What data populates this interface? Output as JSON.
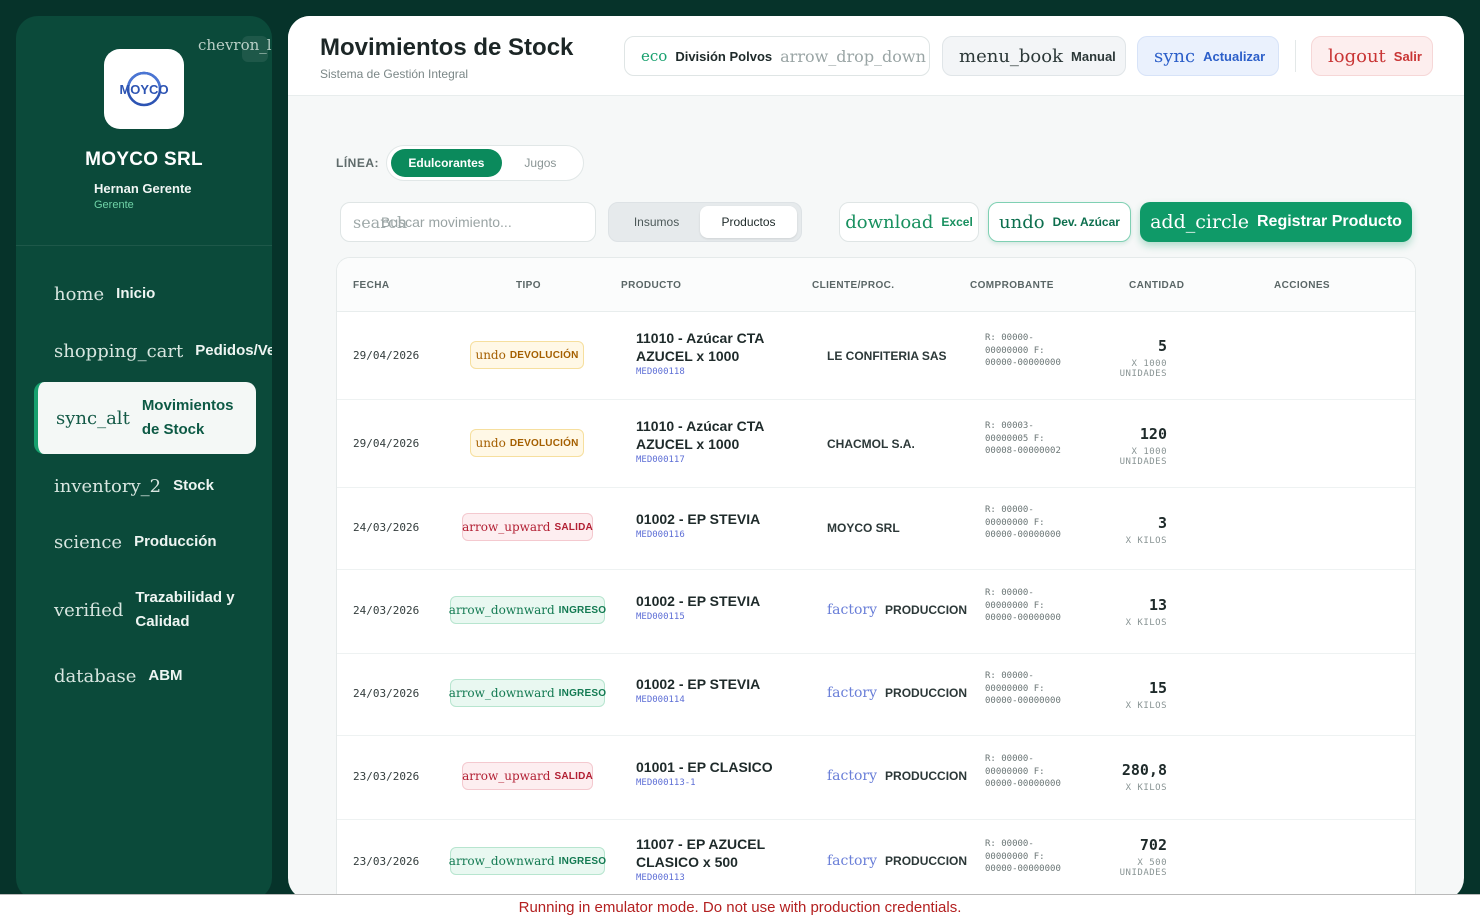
{
  "sidebar": {
    "collapse_icon": "chevron_left",
    "logo_text": "MOYCO",
    "company": "MOYCO SRL",
    "user_name": "Hernan Gerente",
    "user_role": "Gerente",
    "items": [
      {
        "icon": "home",
        "label": "Inicio"
      },
      {
        "icon": "shopping_cart",
        "label": "Pedidos/Ventas"
      },
      {
        "icon": "sync_alt",
        "label": "Movimientos de Stock",
        "active": true
      },
      {
        "icon": "inventory_2",
        "label": "Stock"
      },
      {
        "icon": "science",
        "label": "Producción"
      },
      {
        "icon": "verified",
        "label": "Trazabilidad y Calidad"
      },
      {
        "icon": "database",
        "label": "ABM"
      }
    ]
  },
  "header": {
    "title": "Movimientos de Stock",
    "subtitle": "Sistema de Gestión Integral",
    "division": {
      "icon": "eco",
      "label": "División Polvos",
      "arrow": "arrow_drop_down"
    },
    "manual": {
      "icon": "menu_book",
      "label": "Manual"
    },
    "sync": {
      "icon": "sync",
      "label": "Actualizar"
    },
    "logout": {
      "icon": "logout",
      "label": "Salir"
    }
  },
  "filters": {
    "linea_label": "LÍNEA:",
    "linea_options": [
      "Edulcorantes",
      "Jugos"
    ],
    "linea_selected": "Edulcorantes",
    "search_icon": "search",
    "search_placeholder": "Buscar movimiento...",
    "tipo_options": [
      "Insumos",
      "Productos"
    ],
    "tipo_selected": "Productos"
  },
  "actions": {
    "excel": {
      "icon": "download",
      "label": "Excel"
    },
    "dev": {
      "icon": "undo",
      "label": "Dev. Azúcar"
    },
    "register": {
      "icon": "add_circle",
      "label": "Registrar Producto"
    }
  },
  "table": {
    "columns": [
      "FECHA",
      "TIPO",
      "PRODUCTO",
      "CLIENTE/PROC.",
      "COMPROBANTE",
      "CANTIDAD",
      "ACCIONES"
    ],
    "rows": [
      {
        "fecha": "29/04/2026",
        "tipo_icon": "undo",
        "tipo": "DEVOLUCIÓN",
        "kind": "dev",
        "producto": "11010 - Azúcar CTA AZUCEL x 1000",
        "codigo": "MED000118",
        "cliente_icon": "",
        "cliente": "LE CONFITERIA SAS",
        "comprobante": "R: 00000-00000000 F: 00000-00000000",
        "cantidad": "5",
        "unidad": "X 1000 UNIDADES"
      },
      {
        "fecha": "29/04/2026",
        "tipo_icon": "undo",
        "tipo": "DEVOLUCIÓN",
        "kind": "dev",
        "producto": "11010 - Azúcar CTA AZUCEL x 1000",
        "codigo": "MED000117",
        "cliente_icon": "",
        "cliente": "CHACMOL S.A.",
        "comprobante": "R: 00003-00000005 F: 00008-00000002",
        "cantidad": "120",
        "unidad": "X 1000 UNIDADES"
      },
      {
        "fecha": "24/03/2026",
        "tipo_icon": "arrow_upward",
        "tipo": "SALIDA",
        "kind": "sal",
        "producto": "01002 - EP STEVIA",
        "codigo": "MED000116",
        "cliente_icon": "",
        "cliente": "MOYCO SRL",
        "comprobante": "R: 00000-00000000 F: 00000-00000000",
        "cantidad": "3",
        "unidad": "X KILOS"
      },
      {
        "fecha": "24/03/2026",
        "tipo_icon": "arrow_downward",
        "tipo": "INGRESO",
        "kind": "ing",
        "producto": "01002 - EP STEVIA",
        "codigo": "MED000115",
        "cliente_icon": "factory",
        "cliente": "PRODUCCION",
        "comprobante": "R: 00000-00000000 F: 00000-00000000",
        "cantidad": "13",
        "unidad": "X KILOS"
      },
      {
        "fecha": "24/03/2026",
        "tipo_icon": "arrow_downward",
        "tipo": "INGRESO",
        "kind": "ing",
        "producto": "01002 - EP STEVIA",
        "codigo": "MED000114",
        "cliente_icon": "factory",
        "cliente": "PRODUCCION",
        "comprobante": "R: 00000-00000000 F: 00000-00000000",
        "cantidad": "15",
        "unidad": "X KILOS"
      },
      {
        "fecha": "23/03/2026",
        "tipo_icon": "arrow_upward",
        "tipo": "SALIDA",
        "kind": "sal",
        "producto": "01001 - EP CLASICO",
        "codigo": "MED000113-1",
        "cliente_icon": "factory",
        "cliente": "PRODUCCION",
        "comprobante": "R: 00000-00000000 F: 00000-00000000",
        "cantidad": "280,8",
        "unidad": "X KILOS"
      },
      {
        "fecha": "23/03/2026",
        "tipo_icon": "arrow_downward",
        "tipo": "INGRESO",
        "kind": "ing",
        "producto": "11007 - EP AZUCEL CLASICO x 500",
        "codigo": "MED000113",
        "cliente_icon": "factory",
        "cliente": "PRODUCCION",
        "comprobante": "R: 00000-00000000 F: 00000-00000000",
        "cantidad": "702",
        "unidad": "X 500 UNIDADES"
      }
    ]
  },
  "footer": {
    "message": "Running in emulator mode. Do not use with production credentials."
  },
  "colors": {
    "sidebar": "#0b4a3a",
    "accent": "#0f9a68",
    "danger": "#c93535",
    "info": "#2c5fc9"
  }
}
